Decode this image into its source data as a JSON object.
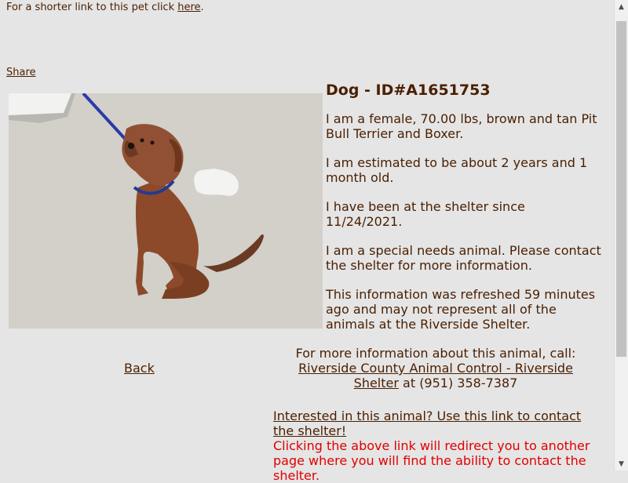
{
  "header": {
    "shortlink_prefix": "For a shorter link to this pet click ",
    "shortlink_link": "here",
    "shortlink_suffix": ".",
    "share": "Share"
  },
  "pet": {
    "photo": "dog-photo",
    "title": "Dog - ID#A1651753",
    "description": "I am a female, 70.00 lbs, brown and tan Pit Bull Terrier and Boxer.",
    "age": "I am estimated to be about 2 years and 1 month old.",
    "since": "I have been at the shelter since 11/24/2021.",
    "special_needs": "I am a special needs animal. Please contact the shelter for more information.",
    "refresh": "This information was refreshed 59 minutes ago and may not represent all of the animals at the Riverside Shelter."
  },
  "nav": {
    "back": "Back"
  },
  "contact": {
    "intro": "For more information about this animal, call:",
    "shelter_link": "Riverside County Animal Control - Riverside Shelter",
    "phone": " at (951) 358-7387"
  },
  "interest": {
    "link": "Interested in this animal? Use this link to contact the shelter!",
    "redirect_note": "Clicking the above link will redirect you to another page where you will find the ability to contact the shelter."
  },
  "colors": {
    "text": "#4a1f00",
    "background": "#e5e5e5",
    "warning": "#e00000"
  }
}
